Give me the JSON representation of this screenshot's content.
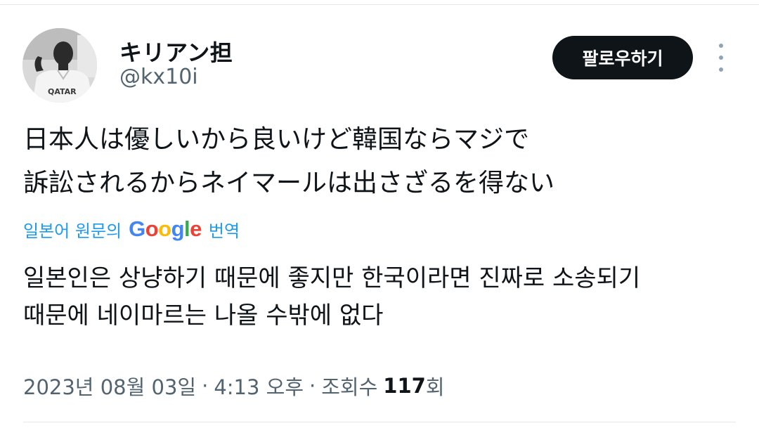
{
  "user": {
    "display_name": "キリアン担",
    "handle": "@kx10i",
    "avatar_shirt_text": "QATAR"
  },
  "actions": {
    "follow_label": "팔로우하기",
    "more_icon": "more-vertical-icon"
  },
  "tweet": {
    "original_lines": [
      "日本人は優しいから良いけど韓国ならマジで",
      "訴訟されるからネイマールは出さざるを得ない"
    ],
    "translate_prefix": "일본어 원문의",
    "translate_brand": "Google",
    "translate_suffix": "번역",
    "translated_lines": [
      "일본인은 상냥하기 때문에 좋지만 한국이라면 진짜로 소송되기",
      "때문에 네이마르는 나올 수밖에 없다"
    ]
  },
  "meta": {
    "date": "2023년 08월 03일",
    "separator": "·",
    "time": "4:13 오후",
    "views_label": "조회수",
    "views_count": "117",
    "views_suffix": "회"
  },
  "colors": {
    "link": "#1d9bf0",
    "text": "#0f1419",
    "secondary": "#536471",
    "button_bg": "#0f1419",
    "google_blue": "#4285f4",
    "google_red": "#ea4335",
    "google_yellow": "#fbbc05",
    "google_green": "#34a853"
  }
}
